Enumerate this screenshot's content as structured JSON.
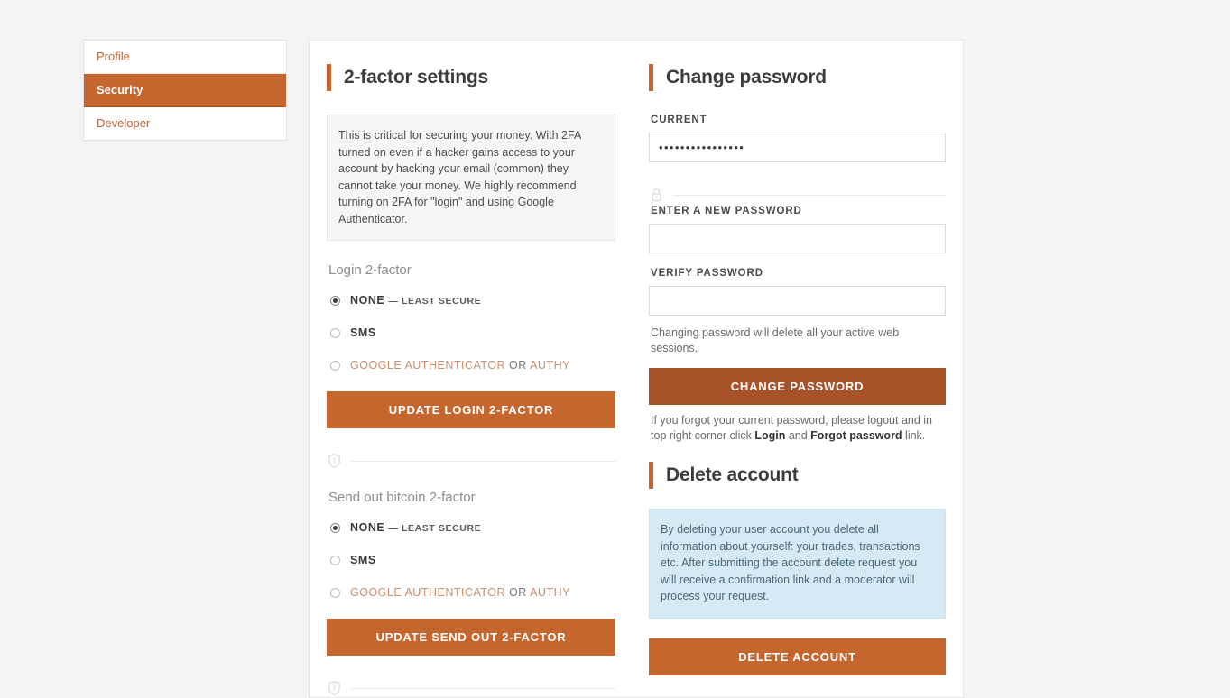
{
  "sidebar": {
    "items": [
      {
        "label": "Profile",
        "active": false
      },
      {
        "label": "Security",
        "active": true
      },
      {
        "label": "Developer",
        "active": false
      }
    ]
  },
  "two_factor": {
    "heading": "2-factor settings",
    "info": "This is critical for securing your money. With 2FA turned on even if a hacker gains access to your account by hacking your email (common) they cannot take your money. We highly recommend turning on 2FA for \"login\" and using Google Authenticator.",
    "login": {
      "subheading": "Login 2-factor",
      "options": [
        {
          "label": "NONE",
          "suffix": "— LEAST SECURE",
          "selected": true,
          "muted": false
        },
        {
          "label": "SMS",
          "suffix": "",
          "selected": false,
          "muted": false
        },
        {
          "label": "GOOGLE AUTHENTICATOR",
          "or": "OR",
          "label2": "AUTHY",
          "suffix": "",
          "selected": false,
          "muted": true
        }
      ],
      "button": "UPDATE LOGIN 2-FACTOR"
    },
    "send_out": {
      "subheading": "Send out bitcoin 2-factor",
      "options": [
        {
          "label": "NONE",
          "suffix": "— LEAST SECURE",
          "selected": true,
          "muted": false
        },
        {
          "label": "SMS",
          "suffix": "",
          "selected": false,
          "muted": false
        },
        {
          "label": "GOOGLE AUTHENTICATOR",
          "or": "OR",
          "label2": "AUTHY",
          "suffix": "",
          "selected": false,
          "muted": true
        }
      ],
      "button": "UPDATE SEND OUT 2-FACTOR"
    },
    "divider_icon": "shield-icon"
  },
  "change_password": {
    "heading": "Change password",
    "current_label": "CURRENT",
    "current_value": "••••••••••••••••",
    "current_placeholder": "",
    "divider_icon": "lock-icon",
    "new_label": "ENTER A NEW PASSWORD",
    "new_value": "",
    "new_placeholder": "",
    "verify_label": "VERIFY PASSWORD",
    "verify_value": "",
    "verify_placeholder": "",
    "helper": "Changing password will delete all your active web sessions.",
    "button": "CHANGE PASSWORD",
    "footnote_pre": "If you forgot your current password, please logout and in top right corner click ",
    "footnote_login": "Login",
    "footnote_mid": " and ",
    "footnote_forgot": "Forgot password",
    "footnote_post": " link."
  },
  "delete_account": {
    "heading": "Delete account",
    "info": "By deleting your user account you delete all information about yourself: your trades, transactions etc. After submitting the account delete request you will receive a confirmation link and a moderator will process your request.",
    "button": "DELETE ACCOUNT"
  },
  "colors": {
    "accent_orange": "#c5662e",
    "accent_brown": "#a8522a",
    "page_bg": "#f4f4f4",
    "info_blue": "#d6eaf5",
    "muted_orange": "#c89070"
  }
}
